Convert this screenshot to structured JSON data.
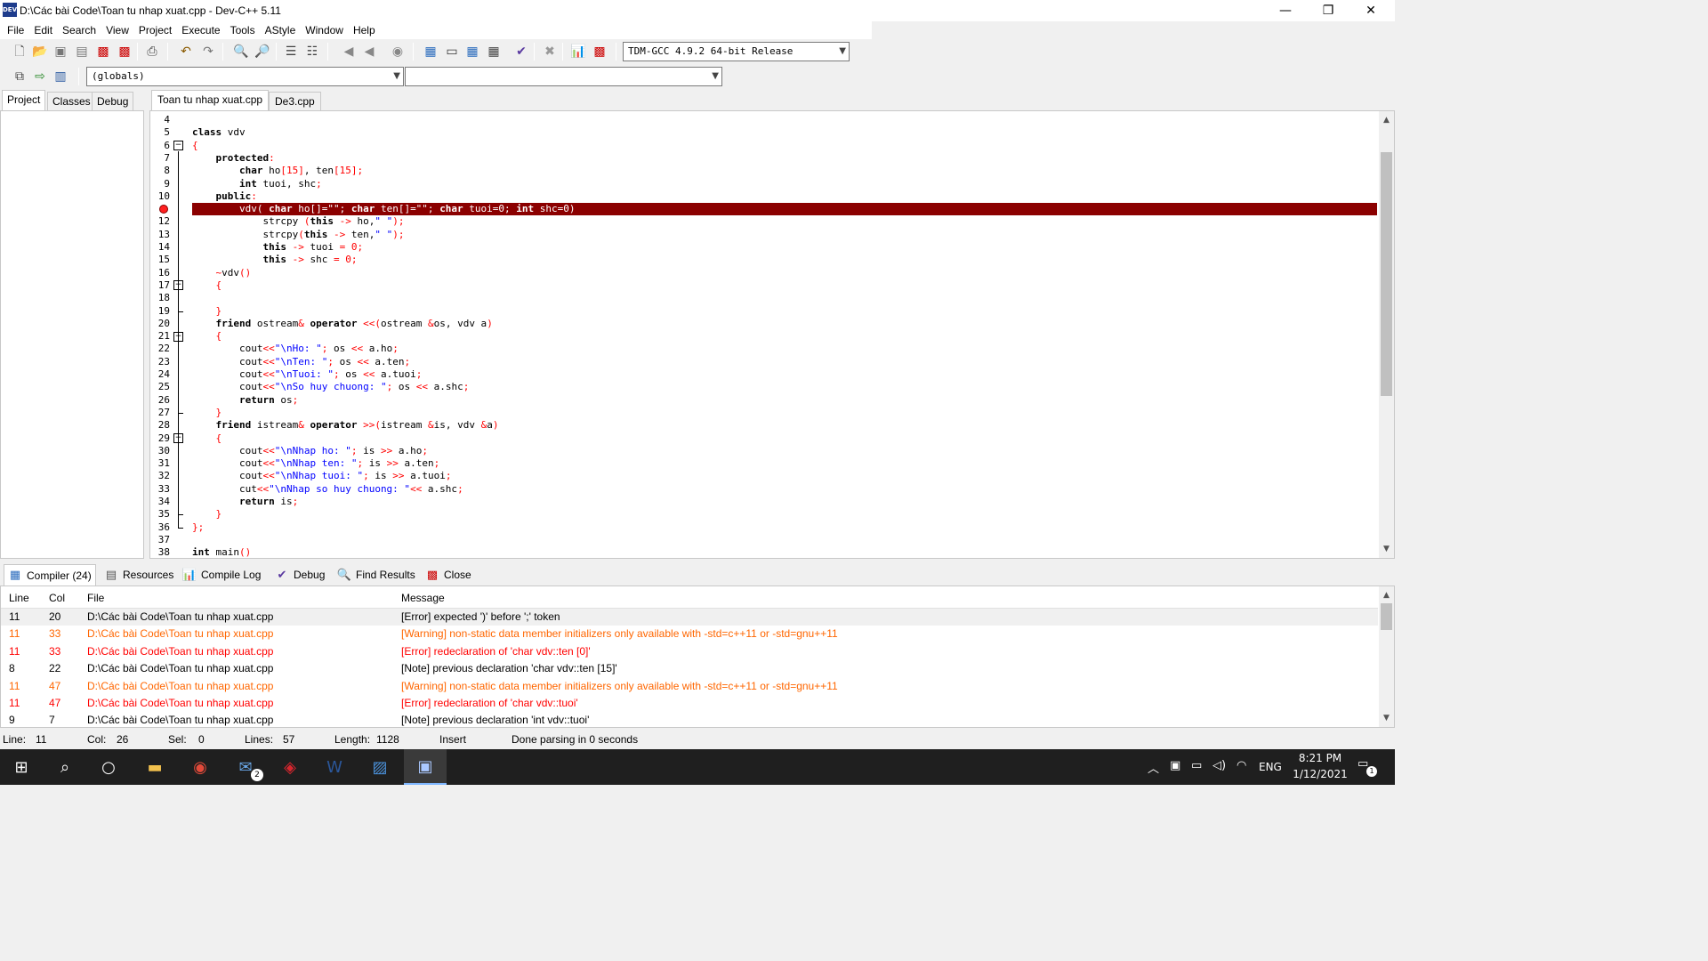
{
  "window": {
    "title": "D:\\Các bài Code\\Toan tu nhap xuat.cpp - Dev-C++ 5.11",
    "minimize": "—",
    "restore": "❐",
    "close": "✕"
  },
  "menu": [
    "File",
    "Edit",
    "Search",
    "View",
    "Project",
    "Execute",
    "Tools",
    "AStyle",
    "Window",
    "Help"
  ],
  "toolbar": {
    "compiler_select": "TDM-GCC 4.9.2 64-bit Release",
    "scope_select": "(globals)",
    "member_select": ""
  },
  "left_tabs": [
    "Project",
    "Classes",
    "Debug"
  ],
  "editor_tabs": [
    "Toan tu nhap xuat.cpp",
    "De3.cpp"
  ],
  "code_lines": [
    {
      "n": "4",
      "html": ""
    },
    {
      "n": "5",
      "html": "<span class=\"k\">class</span> vdv"
    },
    {
      "n": "6",
      "html": "<span class=\"sy\">{</span>"
    },
    {
      "n": "7",
      "html": "    <span class=\"k\">protected</span><span class=\"sy\">:</span>"
    },
    {
      "n": "8",
      "html": "        <span class=\"k\">char</span> ho<span class=\"sy\">[</span><span class=\"n\">15</span><span class=\"sy\">]</span>, ten<span class=\"sy\">[</span><span class=\"n\">15</span><span class=\"sy\">];</span>"
    },
    {
      "n": "9",
      "html": "        <span class=\"k\">int</span> tuoi, shc<span class=\"sy\">;</span>"
    },
    {
      "n": "10",
      "html": "    <span class=\"k\">public</span><span class=\"sy\">:</span>"
    },
    {
      "n": "11",
      "html": "        vdv( <span class=\"k\">char</span> ho[]=\"\"; <span class=\"k\">char</span> ten[]=\"\"; <span class=\"k\">char</span> tuoi=0; <span class=\"k\">int</span> shc=0)",
      "err": true
    },
    {
      "n": "12",
      "html": "            strcpy <span class=\"sy\">(</span><span class=\"k\">this</span> <span class=\"sy\">-&gt;</span> ho,<span class=\"s\">\" \"</span><span class=\"sy\">);</span>"
    },
    {
      "n": "13",
      "html": "            strcpy<span class=\"sy\">(</span><span class=\"k\">this</span> <span class=\"sy\">-&gt;</span> ten,<span class=\"s\">\" \"</span><span class=\"sy\">);</span>"
    },
    {
      "n": "14",
      "html": "            <span class=\"k\">this</span> <span class=\"sy\">-&gt;</span> tuoi <span class=\"sy\">=</span> <span class=\"n\">0</span><span class=\"sy\">;</span>"
    },
    {
      "n": "15",
      "html": "            <span class=\"k\">this</span> <span class=\"sy\">-&gt;</span> shc <span class=\"sy\">=</span> <span class=\"n\">0</span><span class=\"sy\">;</span>"
    },
    {
      "n": "16",
      "html": "    <span class=\"sy\">~</span>vdv<span class=\"sy\">()</span>"
    },
    {
      "n": "17",
      "html": "    <span class=\"sy\">{</span>"
    },
    {
      "n": "18",
      "html": ""
    },
    {
      "n": "19",
      "html": "    <span class=\"sy\">}</span>"
    },
    {
      "n": "20",
      "html": "    <span class=\"k\">friend</span> ostream<span class=\"sy\">&amp;</span> <span class=\"k\">operator</span> <span class=\"sy\">&lt;&lt;(</span>ostream <span class=\"sy\">&amp;</span>os, vdv a<span class=\"sy\">)</span>"
    },
    {
      "n": "21",
      "html": "    <span class=\"sy\">{</span>"
    },
    {
      "n": "22",
      "html": "        cout<span class=\"sy\">&lt;&lt;</span><span class=\"s\">\"\\nHo: \"</span><span class=\"sy\">;</span> os <span class=\"sy\">&lt;&lt;</span> a.ho<span class=\"sy\">;</span>"
    },
    {
      "n": "23",
      "html": "        cout<span class=\"sy\">&lt;&lt;</span><span class=\"s\">\"\\nTen: \"</span><span class=\"sy\">;</span> os <span class=\"sy\">&lt;&lt;</span> a.ten<span class=\"sy\">;</span>"
    },
    {
      "n": "24",
      "html": "        cout<span class=\"sy\">&lt;&lt;</span><span class=\"s\">\"\\nTuoi: \"</span><span class=\"sy\">;</span> os <span class=\"sy\">&lt;&lt;</span> a.tuoi<span class=\"sy\">;</span>"
    },
    {
      "n": "25",
      "html": "        cout<span class=\"sy\">&lt;&lt;</span><span class=\"s\">\"\\nSo huy chuong: \"</span><span class=\"sy\">;</span> os <span class=\"sy\">&lt;&lt;</span> a.shc<span class=\"sy\">;</span>"
    },
    {
      "n": "26",
      "html": "        <span class=\"k\">return</span> os<span class=\"sy\">;</span>"
    },
    {
      "n": "27",
      "html": "    <span class=\"sy\">}</span>"
    },
    {
      "n": "28",
      "html": "    <span class=\"k\">friend</span> istream<span class=\"sy\">&amp;</span> <span class=\"k\">operator</span> <span class=\"sy\">&gt;&gt;(</span>istream <span class=\"sy\">&amp;</span>is, vdv <span class=\"sy\">&amp;</span>a<span class=\"sy\">)</span>"
    },
    {
      "n": "29",
      "html": "    <span class=\"sy\">{</span>"
    },
    {
      "n": "30",
      "html": "        cout<span class=\"sy\">&lt;&lt;</span><span class=\"s\">\"\\nNhap ho: \"</span><span class=\"sy\">;</span> is <span class=\"sy\">&gt;&gt;</span> a.ho<span class=\"sy\">;</span>"
    },
    {
      "n": "31",
      "html": "        cout<span class=\"sy\">&lt;&lt;</span><span class=\"s\">\"\\nNhap ten: \"</span><span class=\"sy\">;</span> is <span class=\"sy\">&gt;&gt;</span> a.ten<span class=\"sy\">;</span>"
    },
    {
      "n": "32",
      "html": "        cout<span class=\"sy\">&lt;&lt;</span><span class=\"s\">\"\\nNhap tuoi: \"</span><span class=\"sy\">;</span> is <span class=\"sy\">&gt;&gt;</span> a.tuoi<span class=\"sy\">;</span>"
    },
    {
      "n": "33",
      "html": "        cut<span class=\"sy\">&lt;&lt;</span><span class=\"s\">\"\\nNhap so huy chuong: \"</span><span class=\"sy\">&lt;&lt;</span> a.shc<span class=\"sy\">;</span>"
    },
    {
      "n": "34",
      "html": "        <span class=\"k\">return</span> is<span class=\"sy\">;</span>"
    },
    {
      "n": "35",
      "html": "    <span class=\"sy\">}</span>"
    },
    {
      "n": "36",
      "html": "<span class=\"sy\">};</span>"
    },
    {
      "n": "37",
      "html": ""
    },
    {
      "n": "38",
      "html": "<span class=\"k\">int</span> main<span class=\"sy\">()</span>"
    }
  ],
  "bottom_tabs": [
    {
      "label": "Compiler (24)",
      "icon": "grid-icon"
    },
    {
      "label": "Resources",
      "icon": "resources-icon"
    },
    {
      "label": "Compile Log",
      "icon": "chart-icon"
    },
    {
      "label": "Debug",
      "icon": "check-icon"
    },
    {
      "label": "Find Results",
      "icon": "find-icon"
    },
    {
      "label": "Close",
      "icon": "close-icon"
    }
  ],
  "messages": {
    "headers": {
      "line": "Line",
      "col": "Col",
      "file": "File",
      "message": "Message"
    },
    "rows": [
      {
        "line": "11",
        "col": "20",
        "file": "D:\\Các bài Code\\Toan tu nhap xuat.cpp",
        "message": "[Error] expected ')' before ';' token",
        "type": "sel"
      },
      {
        "line": "11",
        "col": "33",
        "file": "D:\\Các bài Code\\Toan tu nhap xuat.cpp",
        "message": "[Warning] non-static data member initializers only available with -std=c++11 or -std=gnu++11",
        "type": "warn"
      },
      {
        "line": "11",
        "col": "33",
        "file": "D:\\Các bài Code\\Toan tu nhap xuat.cpp",
        "message": "[Error] redeclaration of 'char vdv::ten [0]'",
        "type": "errc"
      },
      {
        "line": "8",
        "col": "22",
        "file": "D:\\Các bài Code\\Toan tu nhap xuat.cpp",
        "message": "[Note] previous declaration 'char vdv::ten [15]'",
        "type": "note"
      },
      {
        "line": "11",
        "col": "47",
        "file": "D:\\Các bài Code\\Toan tu nhap xuat.cpp",
        "message": "[Warning] non-static data member initializers only available with -std=c++11 or -std=gnu++11",
        "type": "warn"
      },
      {
        "line": "11",
        "col": "47",
        "file": "D:\\Các bài Code\\Toan tu nhap xuat.cpp",
        "message": "[Error] redeclaration of 'char vdv::tuoi'",
        "type": "errc"
      },
      {
        "line": "9",
        "col": "7",
        "file": "D:\\Các bài Code\\Toan tu nhap xuat.cpp",
        "message": "[Note] previous declaration 'int vdv::tuoi'",
        "type": "note"
      }
    ]
  },
  "status": {
    "line_label": "Line:",
    "line_val": "11",
    "col_label": "Col:",
    "col_val": "26",
    "sel_label": "Sel:",
    "sel_val": "0",
    "lines_label": "Lines:",
    "lines_val": "57",
    "length_label": "Length:",
    "length_val": "1128",
    "mode": "Insert",
    "parse": "Done parsing in 0 seconds"
  },
  "taskbar": {
    "mail_badge": "2",
    "lang": "ENG",
    "time": "8:21 PM",
    "date": "1/12/2021",
    "notif_badge": "1"
  }
}
